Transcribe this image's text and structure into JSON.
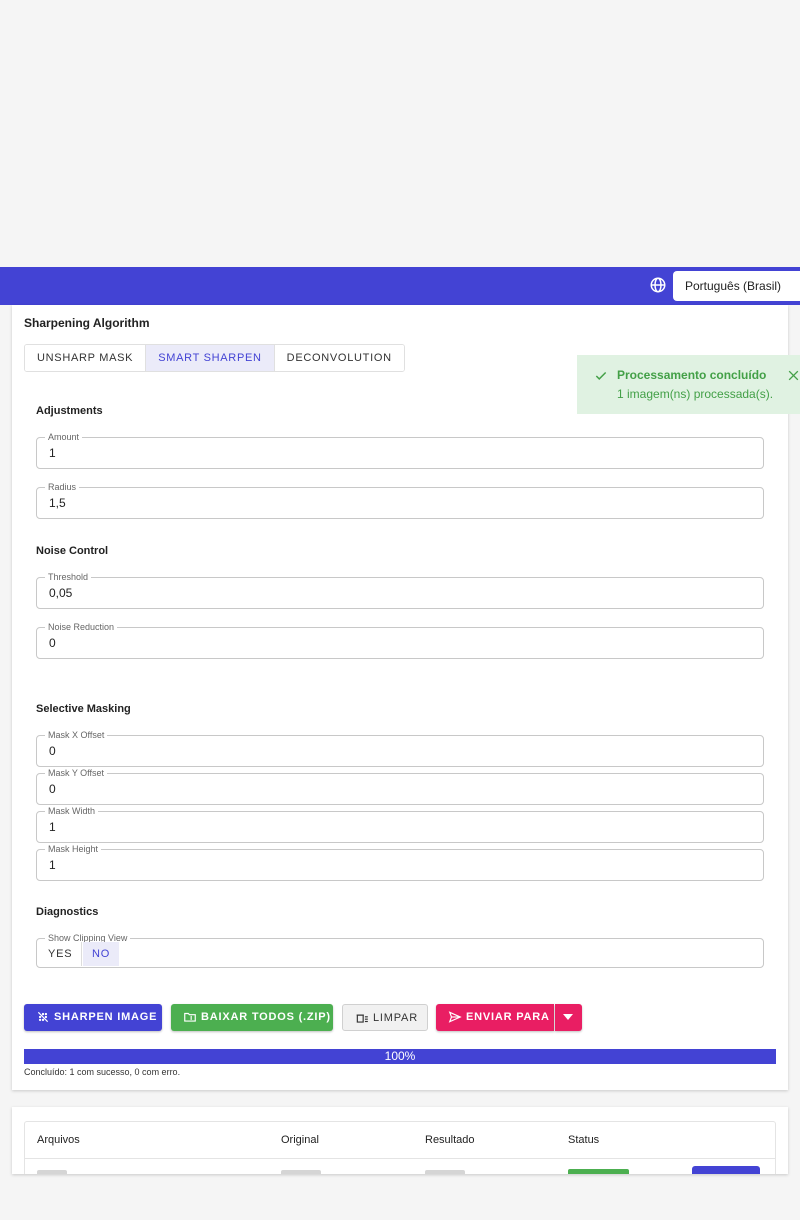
{
  "header": {
    "language": "Português (Brasil)",
    "icons": {
      "language": "globe-icon"
    },
    "colors": {
      "primary": "#4343d4"
    }
  },
  "algorithm": {
    "title": "Sharpening Algorithm",
    "options": [
      "UNSHARP MASK",
      "SMART SHARPEN",
      "DECONVOLUTION"
    ],
    "selected": "SMART SHARPEN"
  },
  "adjustments": {
    "title": "Adjustments",
    "amount": {
      "label": "Amount",
      "value": "1"
    },
    "radius": {
      "label": "Radius",
      "value": "1,5"
    }
  },
  "noise": {
    "title": "Noise Control",
    "threshold": {
      "label": "Threshold",
      "value": "0,05"
    },
    "reduction": {
      "label": "Noise Reduction",
      "value": "0"
    }
  },
  "masking": {
    "title": "Selective Masking",
    "x_offset": {
      "label": "Mask X Offset",
      "value": "0"
    },
    "y_offset": {
      "label": "Mask Y Offset",
      "value": "0"
    },
    "width": {
      "label": "Mask Width",
      "value": "1"
    },
    "height": {
      "label": "Mask Height",
      "value": "1"
    }
  },
  "diagnostics": {
    "title": "Diagnostics",
    "clipping": {
      "label": "Show Clipping View",
      "yes": "YES",
      "no": "NO",
      "selected": "NO"
    }
  },
  "actions": {
    "sharpen": "SHARPEN IMAGE",
    "download_zip": "BAIXAR TODOS (.ZIP)",
    "clear": "LIMPAR",
    "send": "ENVIAR PARA",
    "colors": {
      "sharpen": "#4343d4",
      "download": "#4caf50",
      "send": "#e91e63"
    }
  },
  "progress": {
    "percent": 100,
    "label": "100%",
    "summary": "Concluído: 1 com sucesso, 0 com erro."
  },
  "toast": {
    "title": "Processamento concluído",
    "message": "1 imagem(ns) processada(s).",
    "color": "#43a047"
  },
  "results": {
    "columns": [
      "Arquivos",
      "Original",
      "Resultado",
      "Status"
    ]
  }
}
